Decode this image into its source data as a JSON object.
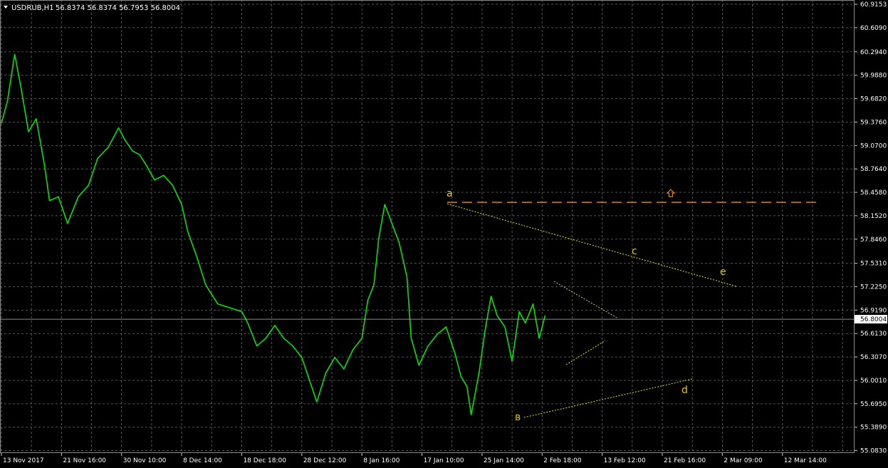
{
  "header": {
    "symbol": "USDRUB,H1",
    "ohlc": "56.8374 56.8374 56.7953 56.8004"
  },
  "colors": {
    "background": "#000000",
    "grid": "#6e6e6e",
    "price_line": "#00e600",
    "annotation": "#e8e800",
    "wave_label": "#e8c400",
    "resistance": "#e0801a",
    "current_price": "#c8c8c8"
  },
  "icons": {
    "resistance_marker": "arrow-up-outline-icon",
    "header_menu": "triangle-down-icon"
  },
  "chart_data": {
    "type": "line",
    "title": "USDRUB,H1",
    "ylim": [
      55.07,
      60.9153
    ],
    "y_ticks": [
      "60.9153",
      "60.6090",
      "60.2940",
      "59.9880",
      "59.6820",
      "59.3760",
      "59.0700",
      "58.7640",
      "58.4580",
      "58.1520",
      "57.8460",
      "57.5310",
      "57.2250",
      "56.9190",
      "56.6130",
      "56.3070",
      "56.0010",
      "55.6950",
      "55.3890",
      "55.0830"
    ],
    "x_ticks": [
      "13 Nov 2017",
      "21 Nov 16:00",
      "30 Nov 10:00",
      "8 Dec 14:00",
      "18 Dec 18:00",
      "28 Dec 12:00",
      "8 Jan 16:00",
      "17 Jan 10:00",
      "25 Jan 14:00",
      "2 Feb 18:00",
      "13 Feb 12:00",
      "21 Feb 16:00",
      "2 Mar 09:00",
      "12 Mar 14:00"
    ],
    "x_tick_index": [
      0,
      1,
      2,
      3,
      4,
      5,
      6,
      7,
      8,
      9,
      10,
      11,
      12,
      13
    ],
    "x_range_index": [
      0,
      14.2
    ],
    "current_price": "56.8004",
    "series": [
      {
        "points": [
          [
            0.0,
            59.36
          ],
          [
            0.1,
            59.65
          ],
          [
            0.22,
            60.26
          ],
          [
            0.32,
            59.85
          ],
          [
            0.45,
            59.25
          ],
          [
            0.58,
            59.42
          ],
          [
            0.72,
            58.8
          ],
          [
            0.8,
            58.35
          ],
          [
            0.95,
            58.4
          ],
          [
            1.1,
            58.05
          ],
          [
            1.28,
            58.4
          ],
          [
            1.45,
            58.55
          ],
          [
            1.6,
            58.9
          ],
          [
            1.78,
            59.05
          ],
          [
            1.95,
            59.3
          ],
          [
            2.05,
            59.15
          ],
          [
            2.18,
            59.0
          ],
          [
            2.3,
            58.95
          ],
          [
            2.42,
            58.8
          ],
          [
            2.55,
            58.62
          ],
          [
            2.7,
            58.68
          ],
          [
            2.85,
            58.55
          ],
          [
            3.0,
            58.3
          ],
          [
            3.1,
            57.95
          ],
          [
            3.25,
            57.62
          ],
          [
            3.4,
            57.25
          ],
          [
            3.6,
            57.0
          ],
          [
            3.8,
            56.95
          ],
          [
            4.0,
            56.9
          ],
          [
            4.1,
            56.75
          ],
          [
            4.25,
            56.45
          ],
          [
            4.4,
            56.55
          ],
          [
            4.55,
            56.72
          ],
          [
            4.7,
            56.55
          ],
          [
            4.85,
            56.45
          ],
          [
            5.0,
            56.3
          ],
          [
            5.15,
            55.95
          ],
          [
            5.25,
            55.72
          ],
          [
            5.4,
            56.1
          ],
          [
            5.55,
            56.3
          ],
          [
            5.7,
            56.15
          ],
          [
            5.85,
            56.4
          ],
          [
            6.0,
            56.55
          ],
          [
            6.1,
            57.05
          ],
          [
            6.2,
            57.25
          ],
          [
            6.28,
            57.85
          ],
          [
            6.38,
            58.3
          ],
          [
            6.5,
            58.05
          ],
          [
            6.62,
            57.8
          ],
          [
            6.75,
            57.35
          ],
          [
            6.82,
            56.55
          ],
          [
            6.95,
            56.2
          ],
          [
            7.1,
            56.45
          ],
          [
            7.25,
            56.6
          ],
          [
            7.4,
            56.7
          ],
          [
            7.55,
            56.35
          ],
          [
            7.65,
            56.05
          ],
          [
            7.75,
            55.92
          ],
          [
            7.82,
            55.55
          ],
          [
            7.95,
            56.1
          ],
          [
            8.05,
            56.65
          ],
          [
            8.15,
            57.1
          ],
          [
            8.25,
            56.85
          ],
          [
            8.38,
            56.7
          ],
          [
            8.5,
            56.25
          ],
          [
            8.62,
            56.9
          ],
          [
            8.72,
            56.75
          ],
          [
            8.85,
            57.0
          ],
          [
            8.95,
            56.55
          ],
          [
            9.05,
            56.85
          ]
        ]
      }
    ],
    "annotations": {
      "labels": [
        "a",
        "в",
        "c",
        "e",
        "d"
      ],
      "resistance_level": 58.35
    }
  }
}
